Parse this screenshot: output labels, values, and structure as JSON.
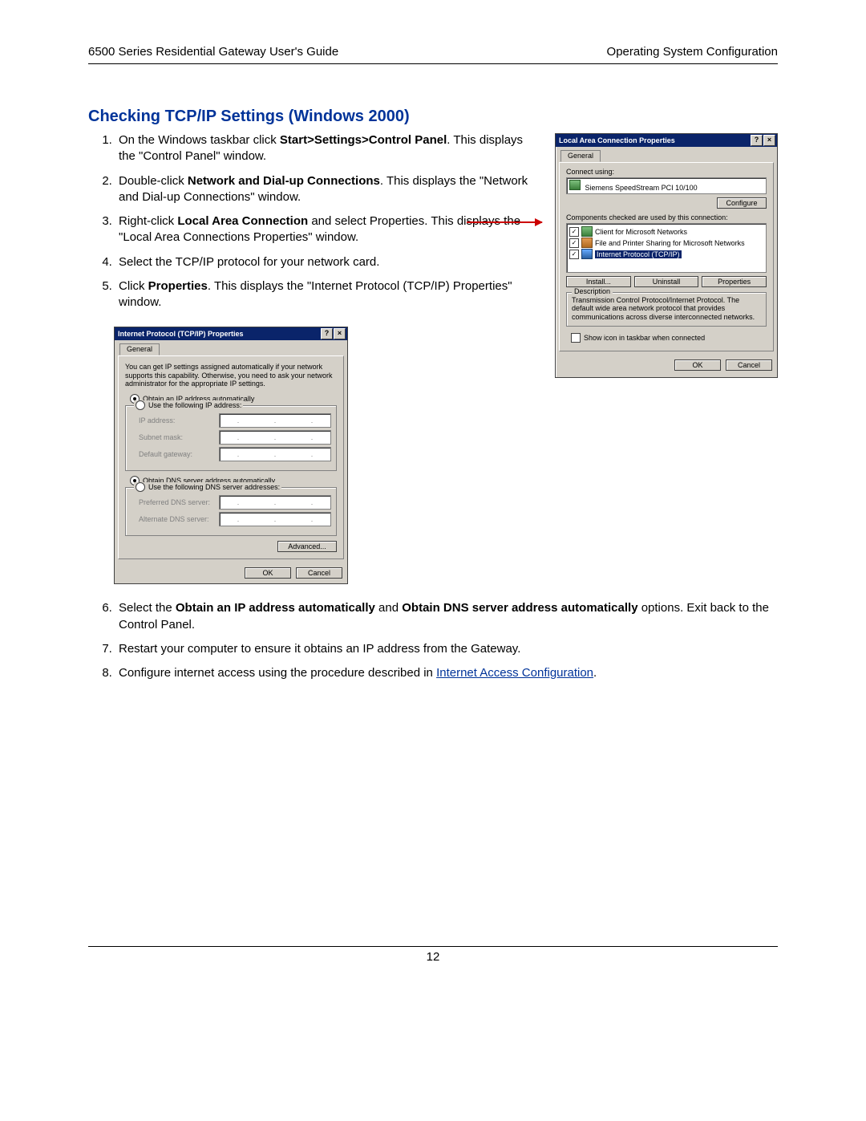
{
  "header": {
    "left": "6500 Series Residential Gateway User's Guide",
    "right": "Operating System Configuration"
  },
  "heading": "Checking TCP/IP Settings (Windows 2000)",
  "steps_top": [
    {
      "pre": "On the Windows taskbar click ",
      "bold": "Start>Settings>Control Panel",
      "post": ". This displays the \"Control Panel\" window."
    },
    {
      "pre": "Double-click ",
      "bold": "Network and Dial-up Connections",
      "post": ". This displays the \"Network and Dial-up Connections\" window."
    },
    {
      "pre": "Right-click ",
      "bold": "Local Area Connection",
      "post": " and select Properties. This displays the \"Local Area Connections Properties\" window."
    },
    {
      "pre": "Select the TCP/IP protocol for your network card.",
      "bold": "",
      "post": ""
    },
    {
      "pre": "Click ",
      "bold": "Properties",
      "post": ". This displays the \"Internet Protocol (TCP/IP) Properties\" window."
    }
  ],
  "steps_bottom": [
    {
      "pre": "Select the ",
      "bold": "Obtain an IP address automatically",
      "mid": " and ",
      "bold2": "Obtain DNS server address automatically",
      "post": " options. Exit back to the Control Panel."
    },
    {
      "pre": "Restart your computer to ensure it obtains an IP address from the Gateway.",
      "bold": "",
      "mid": "",
      "bold2": "",
      "post": ""
    },
    {
      "pre": "Configure internet access using the procedure described in ",
      "bold": "",
      "mid": "",
      "bold2": "",
      "post": "",
      "link": "Internet Access Configuration",
      "post2": "."
    }
  ],
  "lan": {
    "title": "Local Area Connection Properties",
    "tab": "General",
    "connect_label": "Connect using:",
    "adapter": "Siemens SpeedStream PCI 10/100",
    "configure": "Configure",
    "components_label": "Components checked are used by this connection:",
    "items": [
      {
        "label": "Client for Microsoft Networks"
      },
      {
        "label": "File and Printer Sharing for Microsoft Networks"
      },
      {
        "label": "Internet Protocol (TCP/IP)"
      }
    ],
    "install": "Install...",
    "uninstall": "Uninstall",
    "properties": "Properties",
    "description_label": "Description",
    "description": "Transmission Control Protocol/Internet Protocol. The default wide area network protocol that provides communications across diverse interconnected networks.",
    "showicon": "Show icon in taskbar when connected",
    "ok": "OK",
    "cancel": "Cancel"
  },
  "tcp": {
    "title": "Internet Protocol (TCP/IP) Properties",
    "tab": "General",
    "desc": "You can get IP settings assigned automatically if your network supports this capability. Otherwise, you need to ask your network administrator for the appropriate IP settings.",
    "opt_auto_ip": "Obtain an IP address automatically",
    "opt_static_ip": "Use the following IP address:",
    "ip_label": "IP address:",
    "subnet_label": "Subnet mask:",
    "gw_label": "Default gateway:",
    "opt_auto_dns": "Obtain DNS server address automatically",
    "opt_static_dns": "Use the following DNS server addresses:",
    "pref_dns": "Preferred DNS server:",
    "alt_dns": "Alternate DNS server:",
    "advanced": "Advanced...",
    "ok": "OK",
    "cancel": "Cancel"
  },
  "footer": {
    "page": "12"
  }
}
